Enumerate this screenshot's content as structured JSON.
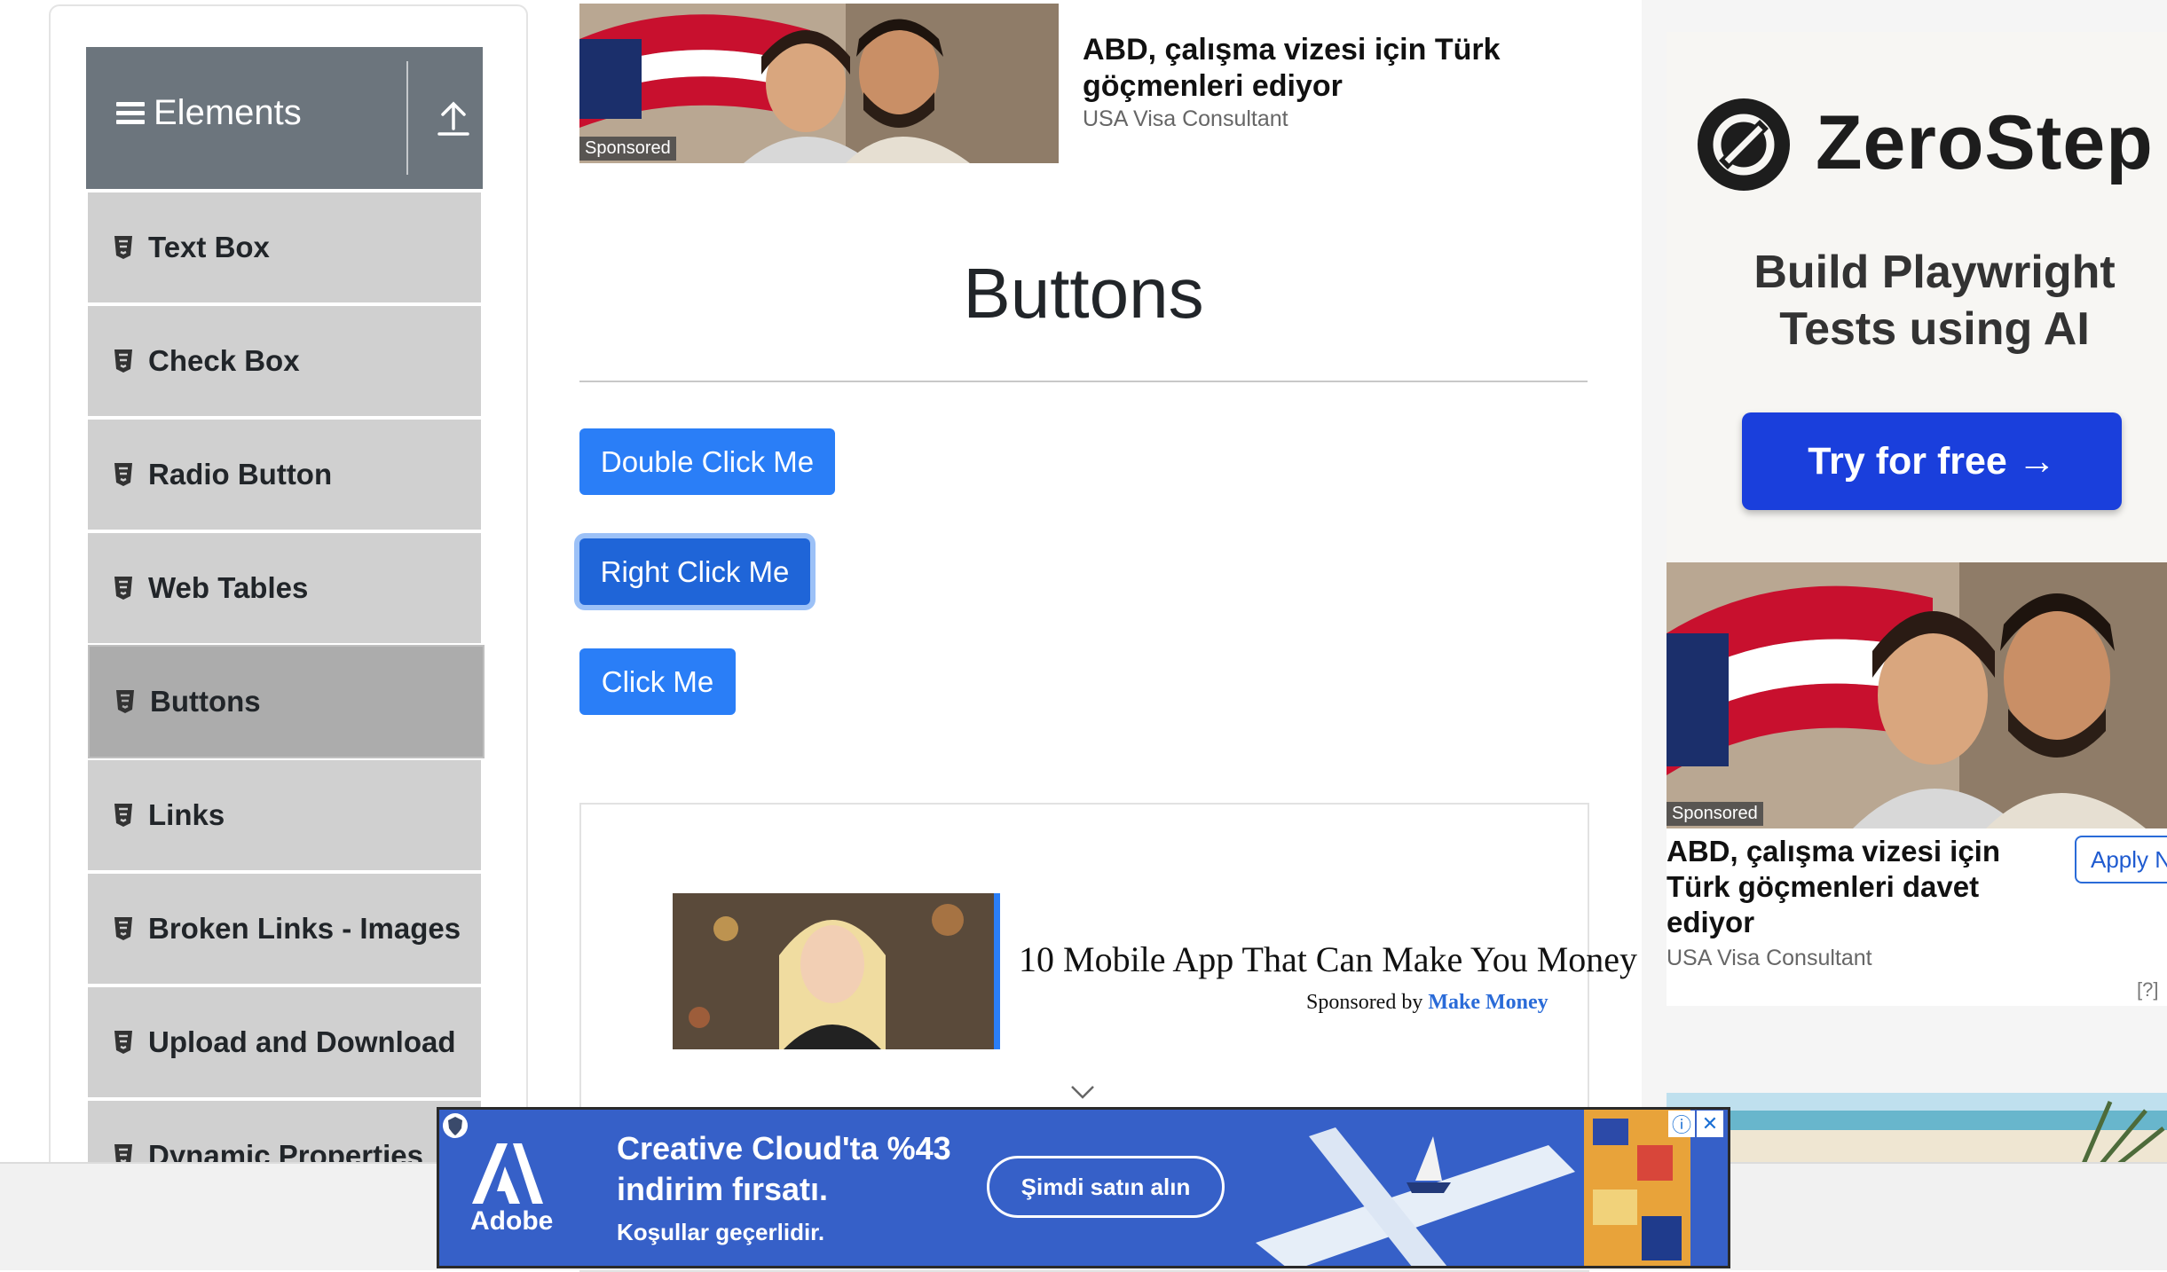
{
  "sidebar": {
    "group_title": "Elements",
    "items": [
      {
        "label": "Text Box"
      },
      {
        "label": "Check Box"
      },
      {
        "label": "Radio Button"
      },
      {
        "label": "Web Tables"
      },
      {
        "label": "Buttons",
        "active": true
      },
      {
        "label": "Links"
      },
      {
        "label": "Broken Links - Images"
      },
      {
        "label": "Upload and Download"
      },
      {
        "label": "Dynamic Properties"
      }
    ]
  },
  "top_ad": {
    "sponsored": "Sponsored",
    "title": "ABD, çalışma vizesi için Türk göçmenleri ediyor",
    "source": "USA Visa Consultant"
  },
  "main": {
    "title": "Buttons",
    "buttons": {
      "double_click": "Double Click Me",
      "right_click": "Right Click Me",
      "click": "Click Me"
    }
  },
  "mid_ad": {
    "title": "10 Mobile App That Can Make You Money",
    "sponsored_by": "Sponsored by",
    "sponsor": "Make Money"
  },
  "right_ads": {
    "zerostep": {
      "name": "ZeroStep",
      "tagline_1": "Build Playwright",
      "tagline_2": "Tests using AI",
      "cta": "Try for free →"
    },
    "visa_ad": {
      "sponsored": "Sponsored",
      "title": "ABD, çalışma vizesi için Türk göçmenleri davet ediyor",
      "source": "USA Visa Consultant",
      "apply": "Apply Now",
      "help": "[?]"
    }
  },
  "bottom_ad": {
    "brand": "Adobe",
    "headline_1": "Creative Cloud'ta %43",
    "headline_2": "indirim fırsatı.",
    "sub": "Koşullar geçerlidir.",
    "cta": "Şimdi satın alın"
  },
  "colors": {
    "primary_button": "#2a7ef7",
    "sidebar_header": "#6c757d",
    "menu_item": "#d0d0d0",
    "menu_item_active": "#acacac",
    "adobe_bg": "#3660c8",
    "zerostep_cta": "#1a3fdc"
  }
}
